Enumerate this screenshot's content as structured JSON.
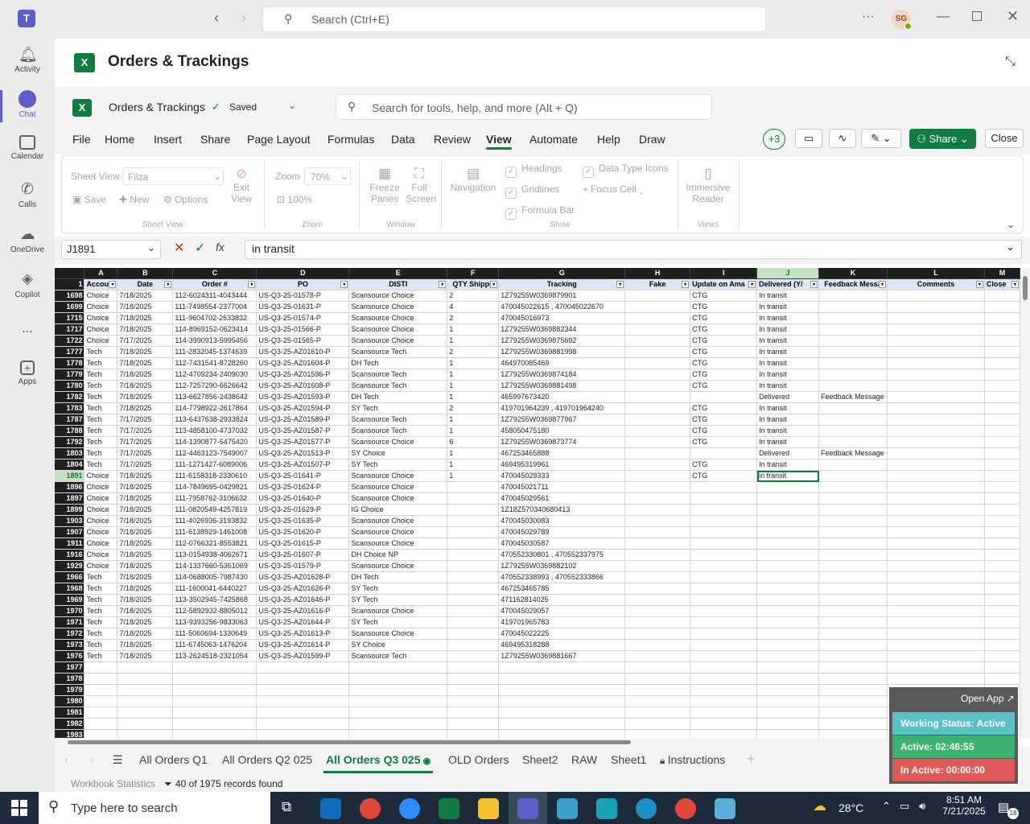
{
  "teams": {
    "search_placeholder": "Search (Ctrl+E)",
    "avatar_initials": "SG",
    "rail": [
      {
        "label": "Activity"
      },
      {
        "label": "Chat"
      },
      {
        "label": "Calendar"
      },
      {
        "label": "Calls"
      },
      {
        "label": "OneDrive"
      },
      {
        "label": "Copilot"
      },
      {
        "label": "..."
      },
      {
        "label": "Apps"
      }
    ]
  },
  "app": {
    "title": "Orders & Trackings",
    "workbook": "Orders & Trackings",
    "saved": "Saved",
    "search_placeholder": "Search for tools, help, and more (Alt + Q)",
    "menu": [
      "File",
      "Home",
      "Insert",
      "Share",
      "Page Layout",
      "Formulas",
      "Data",
      "Review",
      "View",
      "Automate",
      "Help",
      "Draw"
    ],
    "active_menu": "View",
    "coauthors": "+3",
    "share": "Share",
    "close": "Close"
  },
  "ribbon": {
    "sheet_view": "Sheet View",
    "filza": "Filza",
    "save": "Save",
    "new": "New",
    "options": "Options",
    "exit_view_1": "Exit",
    "exit_view_2": "View",
    "g_sheet_view": "Sheet View",
    "zoom": "Zoom",
    "zoom_val": "70%",
    "zoom_100": "100%",
    "g_zoom": "Zoom",
    "freeze_1": "Freeze",
    "freeze_2": "Panes",
    "full_1": "Full",
    "full_2": "Screen",
    "g_window": "Window",
    "navigation": "Navigation",
    "headings": "Headings",
    "gridlines": "Gridlines",
    "formula_bar": "Formula Bar",
    "data_type_icons": "Data Type Icons",
    "focus_cell": "Focus Cell",
    "g_show": "Show",
    "immersive_1": "Immersive",
    "immersive_2": "Reader",
    "g_views": "Views"
  },
  "formula": {
    "namebox": "J1891",
    "value": "in transit"
  },
  "columns": [
    "A",
    "B",
    "C",
    "D",
    "E",
    "F",
    "G",
    "H",
    "I",
    "J",
    "K",
    "L",
    "M"
  ],
  "headers": [
    "Accou",
    "Date",
    "Order #",
    "PO",
    "DISTI",
    "QTY Shippe",
    "Tracking",
    "Fake",
    "Update on Ama",
    "Delivered (Y/",
    "Feedback Messa",
    "Comments",
    "Close"
  ],
  "rows": [
    [
      "1698",
      "Choice",
      "7/18/2025",
      "112-6024311-4043444",
      "US-Q3-25-01578-P",
      "Scansource Choice",
      "2",
      "1Z79255W0369879901",
      "",
      "CTG",
      "In transit",
      "",
      ""
    ],
    [
      "1699",
      "Choice",
      "7/18/2025",
      "111-7498554-2377004",
      "US-Q3-25-01631-P",
      "Scansource Choice",
      "4",
      "470045022615 , 470045022670",
      "",
      "CTG",
      "In transit",
      "",
      ""
    ],
    [
      "1715",
      "Choice",
      "7/18/2025",
      "111-9604702-2633832",
      "US-Q3-25-01574-P",
      "Scansource Choice",
      "2",
      "470045016973",
      "",
      "CTG",
      "In transit",
      "",
      ""
    ],
    [
      "1717",
      "Choice",
      "7/18/2025",
      "114-8969152-0623414",
      "US-Q3-25-01566-P",
      "Scansource Choice",
      "1",
      "1Z79255W0369882344",
      "",
      "CTG",
      "In transit",
      "",
      ""
    ],
    [
      "1722",
      "Choice",
      "7/17/2025",
      "114-3990913-5995456",
      "US-Q3-25-01565-P",
      "Scansource Choice",
      "1",
      "1Z79255W0369875692",
      "",
      "CTG",
      "In transit",
      "",
      ""
    ],
    [
      "1777",
      "Tech",
      "7/18/2025",
      "111-2832045-1374639",
      "US-Q3-25-AZ01610-P",
      "Scansource Tech",
      "2",
      "1Z79255W0369881998",
      "",
      "CTG",
      "In transit",
      "",
      ""
    ],
    [
      "1778",
      "Tech",
      "7/18/2025",
      "112-7431541-8728260",
      "US-Q3-25-AZ01604-P",
      "DH Tech",
      "1",
      "464970085469",
      "",
      "CTG",
      "In transit",
      "",
      ""
    ],
    [
      "1779",
      "Tech",
      "7/18/2025",
      "112-4709234-2409030",
      "US-Q3-25-AZ01596-P",
      "Scansource Tech",
      "1",
      "1Z79255W0369874184",
      "",
      "CTG",
      "In transit",
      "",
      ""
    ],
    [
      "1780",
      "Tech",
      "7/18/2025",
      "112-7257290-6626642",
      "US-Q3-25-AZ01608-P",
      "Scansource Tech",
      "1",
      "1Z79255W0369881498",
      "",
      "CTG",
      "In transit",
      "",
      ""
    ],
    [
      "1782",
      "Tech",
      "7/18/2025",
      "113-6627856-2438642",
      "US-Q3-25-AZ01593-P",
      "DH Tech",
      "1",
      "465997673420",
      "",
      "",
      "Delivered",
      "Feedback Message",
      ""
    ],
    [
      "1783",
      "Tech",
      "7/18/2025",
      "114-7798922-2617864",
      "US-Q3-25-AZ01594-P",
      "SY Tech",
      "2",
      "419701964239 , 419701964240",
      "",
      "CTG",
      "In transit",
      "",
      ""
    ],
    [
      "1787",
      "Tech",
      "7/17/2025",
      "113-6437638-2933824",
      "US-Q3-25-AZ01589-P",
      "Scansource Tech",
      "1",
      "1Z79255W0369877967",
      "",
      "CTG",
      "In transit",
      "",
      ""
    ],
    [
      "1788",
      "Tech",
      "7/17/2025",
      "113-4858100-4737032",
      "US-Q3-25-AZ01587-P",
      "Scansource Tech",
      "1",
      "458050475180",
      "",
      "CTG",
      "In transit",
      "",
      ""
    ],
    [
      "1792",
      "Tech",
      "7/17/2025",
      "114-1390877-5475420",
      "US-Q3-25-AZ01577-P",
      "Scansource Choice",
      "6",
      "1Z79255W0369873774",
      "",
      "CTG",
      "In transit",
      "",
      ""
    ],
    [
      "1803",
      "Tech",
      "7/17/2025",
      "112-4463123-7549007",
      "US-Q3-25-AZ01513-P",
      "SY Choice",
      "1",
      "467253465888",
      "",
      "",
      "Delivered",
      "Feedback Message",
      ""
    ],
    [
      "1804",
      "Tech",
      "7/17/2025",
      "111-1271427-6089006",
      "US-Q3-25-AZ01507-P",
      "SY Tech",
      "1",
      "469495319961",
      "",
      "CTG",
      "In transit",
      "",
      ""
    ],
    [
      "1891",
      "Choice",
      "7/18/2025",
      "111-6158318-2330610",
      "US-Q3-25-01641-P",
      "Scansource Choice",
      "1",
      "470045029333",
      "",
      "CTG",
      "in transit",
      "",
      ""
    ],
    [
      "1896",
      "Choice",
      "7/18/2025",
      "114-7849695-0429821",
      "US-Q3-25-01624-P",
      "Scansource Choice",
      "",
      "470045021711",
      "",
      "",
      "",
      "",
      ""
    ],
    [
      "1897",
      "Choice",
      "7/18/2025",
      "111-7958762-3106632",
      "US-Q3-25-01640-P",
      "Scansource Choice",
      "",
      "470045029561",
      "",
      "",
      "",
      "",
      ""
    ],
    [
      "1899",
      "Choice",
      "7/18/2025",
      "111-0820549-4257819",
      "US-Q3-25-01629-P",
      "IG Choice",
      "",
      "1Z18Z570340680413",
      "",
      "",
      "",
      "",
      ""
    ],
    [
      "1903",
      "Choice",
      "7/18/2025",
      "111-4026936-3193832",
      "US-Q3-25-01635-P",
      "Scansource Choice",
      "",
      "470045030083",
      "",
      "",
      "",
      "",
      ""
    ],
    [
      "1907",
      "Choice",
      "7/18/2025",
      "111-6138929-1461008",
      "US-Q3-25-01620-P",
      "Scansource Choice",
      "",
      "470045029789",
      "",
      "",
      "",
      "",
      ""
    ],
    [
      "1911",
      "Choice",
      "7/18/2025",
      "112-0766321-8553821",
      "US-Q3-25-01615-P",
      "Scansource Choice",
      "",
      "470045030587",
      "",
      "",
      "",
      "",
      ""
    ],
    [
      "1916",
      "Choice",
      "7/18/2025",
      "113-0154938-4062671",
      "US-Q3-25-01607-P",
      "DH Choice NP",
      "",
      "470552330801 , 470552337975",
      "",
      "",
      "",
      "",
      ""
    ],
    [
      "1929",
      "Choice",
      "7/18/2025",
      "114-1337660-5361069",
      "US-Q3-25-01579-P",
      "Scansource Choice",
      "",
      "1Z79255W0369882102",
      "",
      "",
      "",
      "",
      ""
    ],
    [
      "1966",
      "Tech",
      "7/18/2025",
      "114-0688005-7987430",
      "US-Q3-25-AZ01628-P",
      "DH Tech",
      "",
      "470552338993 , 470552333866",
      "",
      "",
      "",
      "",
      ""
    ],
    [
      "1968",
      "Tech",
      "7/18/2025",
      "111-1600041-6440227",
      "US-Q3-25-AZ01626-P",
      "SY Tech",
      "",
      "467253465785",
      "",
      "",
      "",
      "",
      ""
    ],
    [
      "1969",
      "Tech",
      "7/18/2025",
      "113-3502945-7425868",
      "US-Q3-25-AZ01646-P",
      "SY Tech",
      "",
      "471162814025",
      "",
      "",
      "",
      "",
      ""
    ],
    [
      "1970",
      "Tech",
      "7/18/2025",
      "112-5892932-8805012",
      "US-Q3-25-AZ01616-P",
      "Scansource Choice",
      "",
      "470045029057",
      "",
      "",
      "",
      "",
      ""
    ],
    [
      "1971",
      "Tech",
      "7/18/2025",
      "113-9393256-9833063",
      "US-Q3-25-AZ01644-P",
      "SY Tech",
      "",
      "419701965783",
      "",
      "",
      "",
      "",
      ""
    ],
    [
      "1972",
      "Tech",
      "7/18/2025",
      "111-5060694-1330649",
      "US-Q3-25-AZ01613-P",
      "Scansource Choice",
      "",
      "470045022225",
      "",
      "",
      "",
      "",
      ""
    ],
    [
      "1973",
      "Tech",
      "7/18/2025",
      "111-6745063-1476204",
      "US-Q3-25-AZ01614-P",
      "SY Choice",
      "",
      "469495318288",
      "",
      "",
      "",
      "",
      ""
    ],
    [
      "1976",
      "Tech",
      "7/18/2025",
      "113-2624518-2321054",
      "US-Q3-25-AZ01599-P",
      "Scansource Tech",
      "",
      "1Z79255W0369881667",
      "",
      "",
      "",
      "",
      ""
    ],
    [
      "1977",
      "",
      "",
      "",
      "",
      "",
      "",
      "",
      "",
      "",
      "",
      "",
      ""
    ],
    [
      "1978",
      "",
      "",
      "",
      "",
      "",
      "",
      "",
      "",
      "",
      "",
      "",
      ""
    ],
    [
      "1979",
      "",
      "",
      "",
      "",
      "",
      "",
      "",
      "",
      "",
      "",
      "",
      ""
    ],
    [
      "1980",
      "",
      "",
      "",
      "",
      "",
      "",
      "",
      "",
      "",
      "",
      "",
      ""
    ],
    [
      "1981",
      "",
      "",
      "",
      "",
      "",
      "",
      "",
      "",
      "",
      "",
      "",
      ""
    ],
    [
      "1982",
      "",
      "",
      "",
      "",
      "",
      "",
      "",
      "",
      "",
      "",
      "",
      ""
    ],
    [
      "1983",
      "",
      "",
      "",
      "",
      "",
      "",
      "",
      "",
      "",
      "",
      "",
      ""
    ]
  ],
  "selected_row": "1891",
  "sheets": [
    "All Orders Q1",
    "All Orders Q2 025",
    "All Orders Q3 025",
    "OLD Orders",
    "Sheet2",
    "RAW",
    "Sheet1",
    "Instructions"
  ],
  "active_sheet": "All Orders Q3 025",
  "status": {
    "stats": "Workbook Statistics",
    "records": "40 of 1975 records found"
  },
  "overlay": {
    "open_app": "Open App",
    "working": "Working Status: Active",
    "active": "Active: 02:46:55",
    "inactive": "In Active: 00:00:00"
  },
  "taskbar": {
    "search": "Type here to search",
    "temp": "28°C",
    "time": "8:51 AM",
    "date": "7/21/2025",
    "notif": "18"
  }
}
